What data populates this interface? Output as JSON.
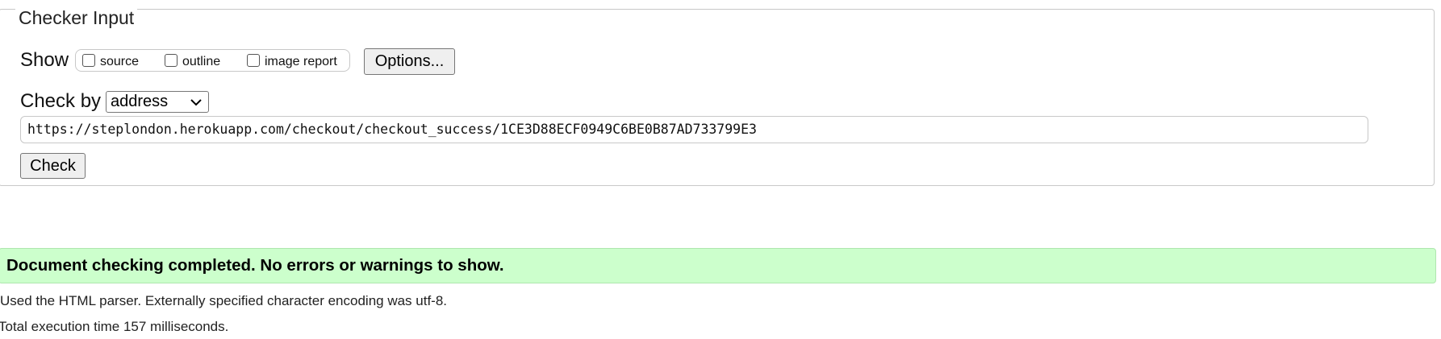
{
  "checker_input": {
    "legend": "Checker Input",
    "show": {
      "label": "Show",
      "options": [
        {
          "label": "source",
          "checked": false
        },
        {
          "label": "outline",
          "checked": false
        },
        {
          "label": "image report",
          "checked": false
        }
      ],
      "options_button_label": "Options..."
    },
    "check_by": {
      "label": "Check by",
      "selected": "address"
    },
    "url_value": "https://steplondon.herokuapp.com/checkout/checkout_success/1CE3D88ECF0949C6BE0B87AD733799E3",
    "check_button_label": "Check"
  },
  "result": {
    "message": "Document checking completed. No errors or warnings to show.",
    "color": "#ccffcc"
  },
  "info": {
    "parser": "Used the HTML parser. Externally specified character encoding was utf-8.",
    "execution_time": "Total execution time 157 milliseconds."
  }
}
